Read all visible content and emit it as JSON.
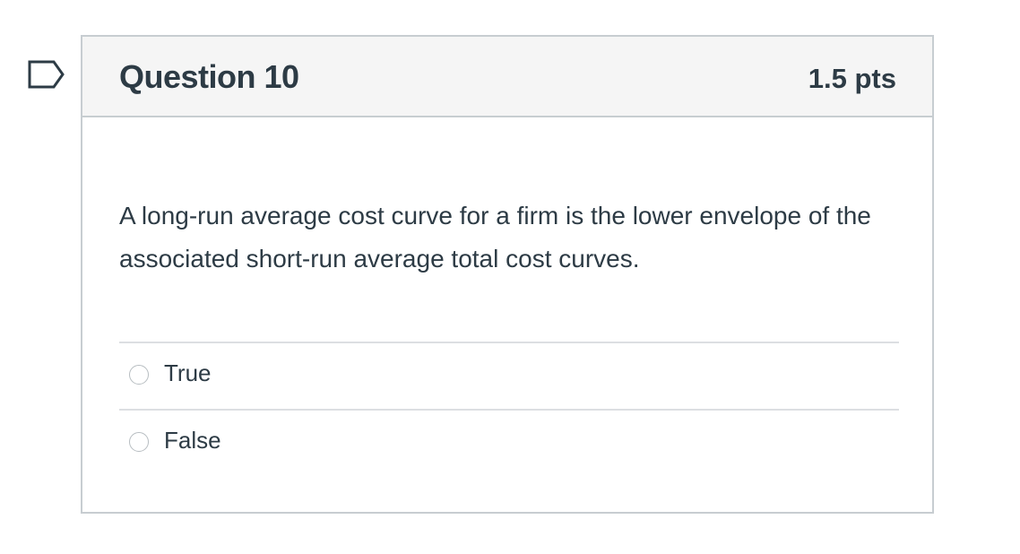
{
  "question": {
    "title": "Question 10",
    "points": "1.5 pts",
    "text": "A long-run average cost curve for a firm is the lower envelope of the associated short-run average total cost curves.",
    "answers": [
      {
        "label": "True"
      },
      {
        "label": "False"
      }
    ]
  },
  "colors": {
    "text": "#2d3b45",
    "header_bg": "#f5f5f5",
    "border": "#c7cdd1"
  },
  "icons": {
    "flag": "flag-question-icon"
  }
}
